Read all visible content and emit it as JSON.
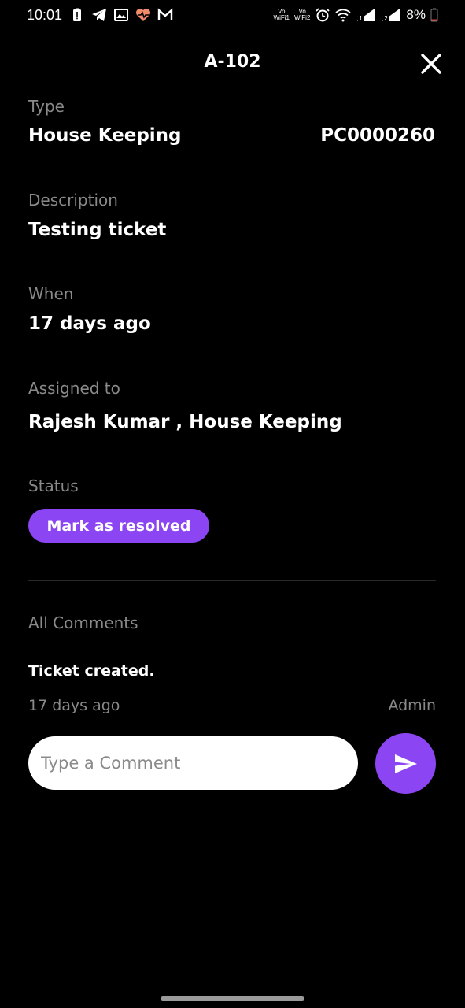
{
  "status_bar": {
    "time": "10:01",
    "vowifi1_line1": "Vo",
    "vowifi1_line2": "WiFi1",
    "vowifi2_line1": "Vo",
    "vowifi2_line2": "WiFi2",
    "sim1": "1",
    "sim2": "2",
    "battery": "8%",
    "battery_color": "#e53935",
    "left_icons": [
      "battery-alert-icon",
      "telegram-icon",
      "gallery-icon",
      "heart-pulse-icon",
      "gmail-icon"
    ],
    "right_icons": [
      "alarm-icon",
      "wifi-icon",
      "signal-icon",
      "signal-icon",
      "battery-icon"
    ]
  },
  "header": {
    "title": "A-102",
    "close_icon": "close-icon"
  },
  "ticket": {
    "type_label": "Type",
    "type_value": "House Keeping",
    "ticket_id": "PC0000260",
    "description_label": "Description",
    "description_value": "Testing ticket",
    "when_label": "When",
    "when_value": "17 days ago",
    "assigned_label": "Assigned to",
    "assigned_value": "Rajesh Kumar , House Keeping",
    "status_label": "Status",
    "resolve_button": "Mark as resolved"
  },
  "comments": {
    "section_label": "All Comments",
    "items": [
      {
        "text": "Ticket created.",
        "time": "17 days ago",
        "author": "Admin"
      }
    ],
    "input_placeholder": "Type a Comment",
    "send_icon": "send-icon"
  },
  "colors": {
    "accent": "#8b45f2",
    "background": "#000000",
    "muted_text": "#8a8a8a"
  }
}
